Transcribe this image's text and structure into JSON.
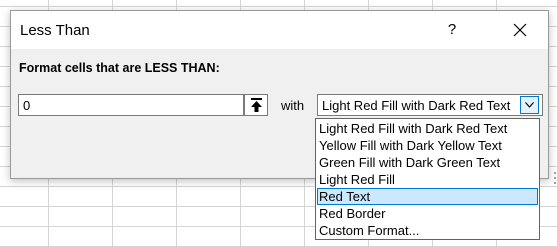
{
  "dialog": {
    "title": "Less Than",
    "help_label": "?",
    "prompt": "Format cells that are LESS THAN:",
    "value": "0",
    "with_label": "with",
    "selected_format": "Light Red Fill with Dark Red Text",
    "options": [
      "Light Red Fill with Dark Red Text",
      "Yellow Fill with Dark Yellow Text",
      "Green Fill with Dark Green Text",
      "Light Red Fill",
      "Red Text",
      "Red Border",
      "Custom Format..."
    ],
    "highlighted_option": "Red Text",
    "accent_color": "#0078d7",
    "highlight_color": "#cce8ff"
  }
}
